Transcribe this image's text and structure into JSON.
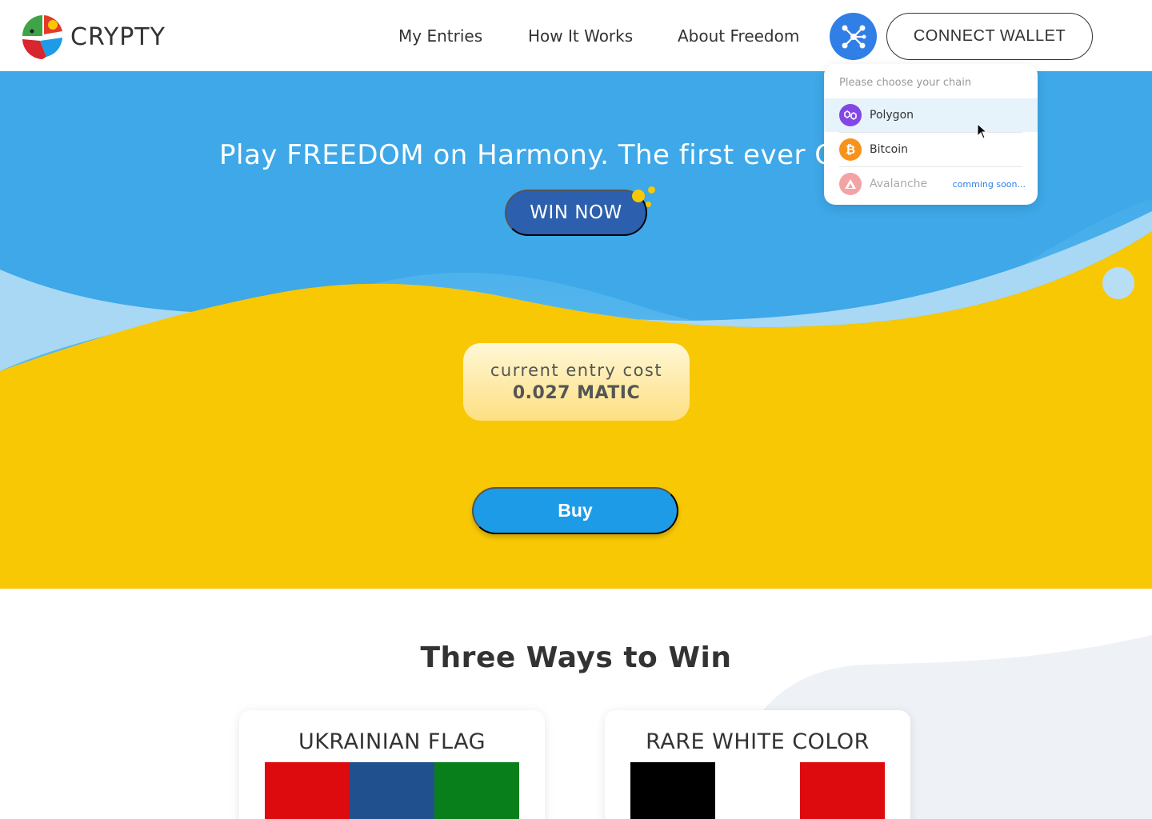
{
  "brand": {
    "name": "CRYPTY"
  },
  "nav": {
    "items": [
      "My Entries",
      "How It Works",
      "About Freedom"
    ],
    "connect_label": "CONNECT WALLET",
    "chain_icon": "network-icon"
  },
  "hero": {
    "title": "Play FREEDOM on Harmony. The first ever C",
    "win_label": "WIN NOW",
    "cost_label": "current entry cost",
    "cost_value": "0.027 MATIC",
    "buy_label": "Buy"
  },
  "chain_menu": {
    "title": "Please choose your chain",
    "items": [
      {
        "label": "Polygon",
        "icon": "polygon-icon",
        "color": "#8247e5",
        "selected": true
      },
      {
        "label": "Bitcoin",
        "icon": "bitcoin-icon",
        "color": "#f7931a"
      },
      {
        "label": "Avalanche",
        "icon": "avalanche-icon",
        "color": "#e84142",
        "disabled": true,
        "badge": "comming soon..."
      }
    ]
  },
  "ways": {
    "title": "Three Ways to Win",
    "cards": [
      {
        "title": "UKRAINIAN FLAG",
        "colors": [
          "#dd0a0e",
          "#21508f",
          "#097f1c"
        ]
      },
      {
        "title": "RARE WHITE COLOR",
        "colors": [
          "#000000",
          "#ffffff",
          "#dd0a0e"
        ]
      }
    ]
  },
  "colors": {
    "sky": "#33a3e6",
    "gold": "#f8c804",
    "accent": "#2f7fe6",
    "win_button": "#2c5fad",
    "buy_button": "#1e9be6"
  }
}
